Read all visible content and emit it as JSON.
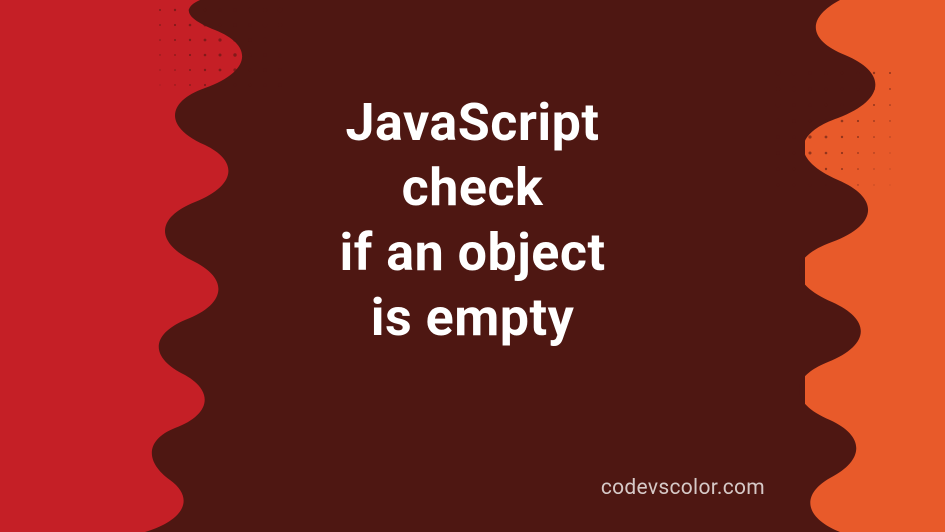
{
  "title": {
    "line1": "JavaScript",
    "line2": "check",
    "line3": "if an object",
    "line4": "is empty"
  },
  "watermark": "codevscolor.com",
  "colors": {
    "background_dark": "#4e1712",
    "left_red": "#c51f26",
    "right_orange": "#e85a2a",
    "text": "#ffffff",
    "watermark": "#d6c9c7"
  }
}
